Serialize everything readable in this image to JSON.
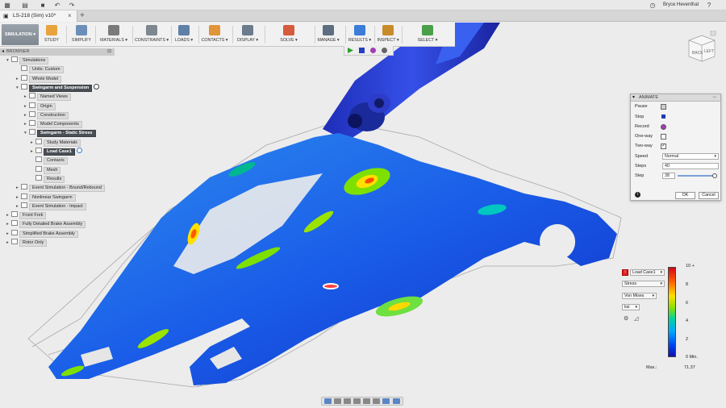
{
  "app": {
    "document_title": "LS-218 (Sim) v10*",
    "user_name": "Bryce Heventhal"
  },
  "ribbon": {
    "workspace": "SIMULATION ▾",
    "groups": [
      {
        "label": "STUDY",
        "color": "#e8a43c"
      },
      {
        "label": "SIMPLIFY",
        "color": "#6b8fb8"
      },
      {
        "label": "MATERIALS ▾",
        "color": "#7a7a7a"
      },
      {
        "label": "CONSTRAINTS ▾",
        "color": "#7d8790"
      },
      {
        "label": "LOADS ▾",
        "color": "#5e7fa8"
      },
      {
        "label": "CONTACTS ▾",
        "color": "#e0953a"
      },
      {
        "label": "DISPLAY ▾",
        "color": "#6b7c8c"
      },
      {
        "label": "SOLVE ▾",
        "color": "#d65a3c"
      },
      {
        "label": "MANAGE ▾",
        "color": "#5d6e80"
      },
      {
        "label": "RESULTS ▾",
        "color": "#3b7dd8"
      },
      {
        "label": "INSPECT ▾",
        "color": "#c88b2a"
      },
      {
        "label": "SELECT ▾",
        "color": "#49a048"
      }
    ]
  },
  "browser": {
    "title": "BROWSER",
    "nodes": [
      {
        "label": "Simulations",
        "level": 0,
        "tri": "▾",
        "dark": false
      },
      {
        "label": "Units: Custom",
        "level": 1,
        "tri": "",
        "dark": false
      },
      {
        "label": "Whole Model",
        "level": 1,
        "tri": "▸",
        "dark": false
      },
      {
        "label": "Swingarm and Suspension",
        "level": 1,
        "tri": "▾",
        "dark": true
      },
      {
        "label": "Named Views",
        "level": 2,
        "tri": "▸",
        "dark": false
      },
      {
        "label": "Origin",
        "level": 2,
        "tri": "▸",
        "dark": false
      },
      {
        "label": "Construction",
        "level": 2,
        "tri": "▸",
        "dark": false
      },
      {
        "label": "Model Components",
        "level": 2,
        "tri": "▸",
        "dark": false
      },
      {
        "label": "Swingarm - Static Stress",
        "level": 2,
        "tri": "▾",
        "dark": true
      },
      {
        "label": "Study Materials",
        "level": 3,
        "tri": "▸",
        "dark": false
      },
      {
        "label": "Load Case1",
        "level": 3,
        "tri": "▸",
        "dark": true
      },
      {
        "label": "Contacts",
        "level": 3,
        "tri": "",
        "dark": false
      },
      {
        "label": "Mesh",
        "level": 3,
        "tri": "",
        "dark": false
      },
      {
        "label": "Results",
        "level": 3,
        "tri": "",
        "dark": false
      },
      {
        "label": "Event Simulation - Bound/Rebound",
        "level": 1,
        "tri": "▸",
        "dark": false
      },
      {
        "label": "Nonlinear Swingarm",
        "level": 1,
        "tri": "▸",
        "dark": false
      },
      {
        "label": "Event Simulation - Impact",
        "level": 1,
        "tri": "▸",
        "dark": false
      },
      {
        "label": "Front Fork",
        "level": 0,
        "tri": "▸",
        "dark": false
      },
      {
        "label": "Fully Detailed Brake Assembly",
        "level": 0,
        "tri": "▸",
        "dark": false
      },
      {
        "label": "Simplified Brake Assembly",
        "level": 0,
        "tri": "▸",
        "dark": false
      },
      {
        "label": "Rotor Only",
        "level": 0,
        "tri": "▸",
        "dark": false
      }
    ]
  },
  "viewcube": {
    "face_front": "BACK",
    "face_right": "LEFT"
  },
  "animate": {
    "title": "ANIMATE",
    "pause_label": "Pause",
    "stop_label": "Stop",
    "record_label": "Record",
    "oneway_label": "One-way",
    "twoway_label": "Two-way",
    "speed_label": "Speed",
    "speed_value": "Normal",
    "steps_label": "Steps",
    "steps_value": "40",
    "step_label": "Step",
    "step_value": "38",
    "ok_label": "OK",
    "cancel_label": "Cancel"
  },
  "legend": {
    "load_case": "Load Case1",
    "result_type": "Stress",
    "component": "Von Mises",
    "unit": "ksi",
    "ticks": [
      "10 +",
      "8",
      "6",
      "4",
      "2",
      "0 Min."
    ],
    "max_label": "Max.:",
    "max_value": "71.37"
  },
  "colors": {
    "accent_blue": "#3b7dd8",
    "stress_high": "#d4081a",
    "stress_low": "#1010b0"
  }
}
